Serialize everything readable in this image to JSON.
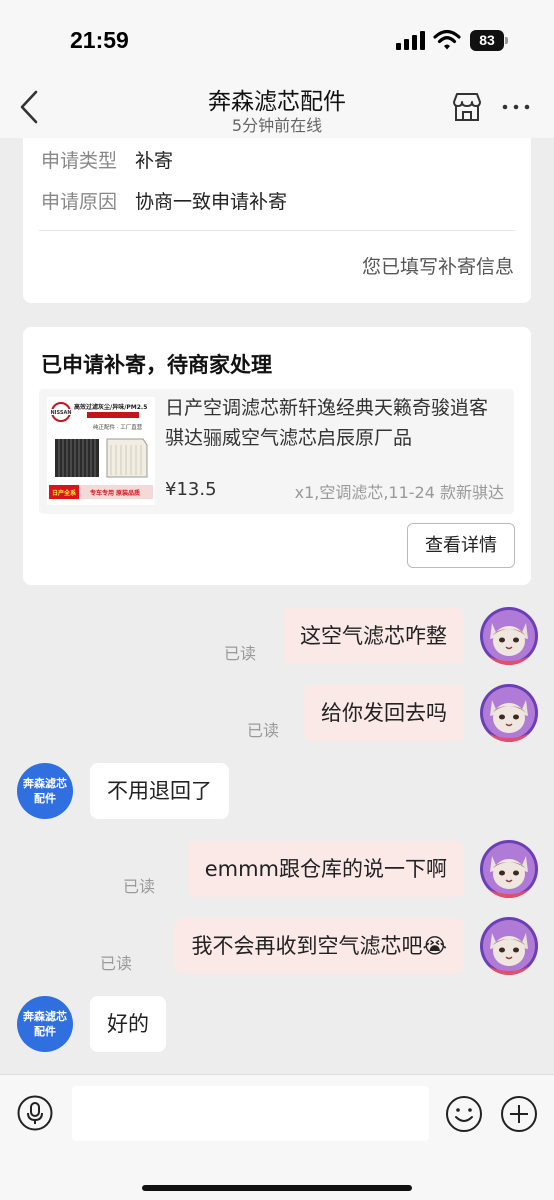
{
  "status_bar": {
    "time": "21:59",
    "battery": "83"
  },
  "header": {
    "title": "奔森滤芯配件",
    "subtitle": "5分钟前在线"
  },
  "request_card": {
    "type_label": "申请类型",
    "type_value": "补寄",
    "reason_label": "申请原因",
    "reason_value": "协商一致申请补寄",
    "filled_note": "您已填写补寄信息"
  },
  "product_card": {
    "title": "已申请补寄，待商家处理",
    "product_title": "日产空调滤芯新轩逸经典天籁奇骏逍客骐达骊威空气滤芯启辰原厂品",
    "price": "¥13.5",
    "spec": "x1,空调滤芯,11-24 款新骐达",
    "detail_button": "查看详情",
    "thumb": {
      "brand": "NISSAN",
      "headline": "高效过滤灰尘/异味/PM2.5",
      "tagline": "纯正配件 · 工厂直营",
      "badge_series": "日产全系",
      "badge_text": "专车专用 原装品质"
    }
  },
  "shop_avatar": {
    "line1": "奔森滤芯",
    "line2": "配件"
  },
  "messages": [
    {
      "side": "out",
      "text": "这空气滤芯咋整",
      "read": "已读"
    },
    {
      "side": "out",
      "text": "给你发回去吗",
      "read": "已读"
    },
    {
      "side": "in",
      "text": "不用退回了"
    },
    {
      "side": "out",
      "text": "emmm跟仓库的说一下啊",
      "read": "已读"
    },
    {
      "side": "out",
      "text": "我不会再收到空气滤芯吧😭",
      "read": "已读"
    },
    {
      "side": "in",
      "text": "好的"
    }
  ],
  "input": {
    "placeholder": ""
  },
  "colors": {
    "outgoing_bubble": "#fbe9e8",
    "shop_avatar": "#2f6fe0"
  }
}
